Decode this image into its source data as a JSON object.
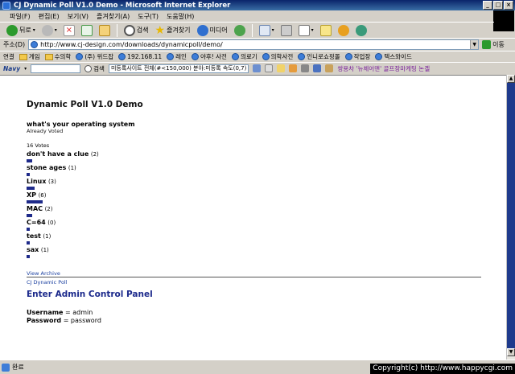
{
  "window": {
    "title": "CJ Dynamic Poll V1.0 Demo - Microsoft Internet Explorer",
    "controls": {
      "minimize": "_",
      "maximize": "□",
      "close": "×"
    }
  },
  "menu": [
    "파일(F)",
    "편집(E)",
    "보기(V)",
    "즐겨찾기(A)",
    "도구(T)",
    "도움말(H)"
  ],
  "toolbar": {
    "back": "뒤로",
    "search": "검색",
    "favorites": "즐겨찾기",
    "media": "미디어"
  },
  "address": {
    "label": "주소(D)",
    "url": "http://www.cj-design.com/downloads/dynamicpoll/demo/",
    "go": "이동"
  },
  "links": {
    "label": "연결",
    "items": [
      "게임",
      "수의학",
      "(주) 위드잡",
      "192.168.11",
      "레인",
      "야후! 사전",
      "의료기",
      "의학사전",
      "인니로쇼핑몰",
      "작업장",
      "텍스와이드"
    ]
  },
  "navy": {
    "logo": "Navy",
    "search_label": "검색",
    "field_text": "미등록사이트 전체(#<150,000) 분야:미등록 속도(0,7)",
    "ad_text": "쌍용차 '뉴체어맨' 골프장마케팅 논겔"
  },
  "page": {
    "title": "Dynamic Poll V1.0 Demo",
    "question": "what's your operating system",
    "status": "Already Voted",
    "votes": "16 Votes",
    "options": [
      {
        "label": "don't have a clue",
        "count": "(2)",
        "votes": 2
      },
      {
        "label": "stone ages",
        "count": "(1)",
        "votes": 1
      },
      {
        "label": "Linux",
        "count": "(3)",
        "votes": 3
      },
      {
        "label": "XP",
        "count": "(6)",
        "votes": 6
      },
      {
        "label": "MAC",
        "count": "(2)",
        "votes": 2
      },
      {
        "label": "C=64",
        "count": "(0)",
        "votes": 0
      },
      {
        "label": "test",
        "count": "(1)",
        "votes": 1
      },
      {
        "label": "sax",
        "count": "(1)",
        "votes": 1
      }
    ],
    "view_archive": "View Archive",
    "brand": "CJ Dynamic Poll",
    "admin_title": "Enter Admin Control Panel",
    "username_label": "Username",
    "username_value": "= admin",
    "password_label": "Password",
    "password_value": "= password"
  },
  "status": {
    "text": "완료",
    "copyright": "Copyright(c) http://www.happycgi.com"
  },
  "colors": {
    "bar": "#1e2a8a",
    "admin_title": "#1c2a8c",
    "link": "#1a3fa0"
  }
}
